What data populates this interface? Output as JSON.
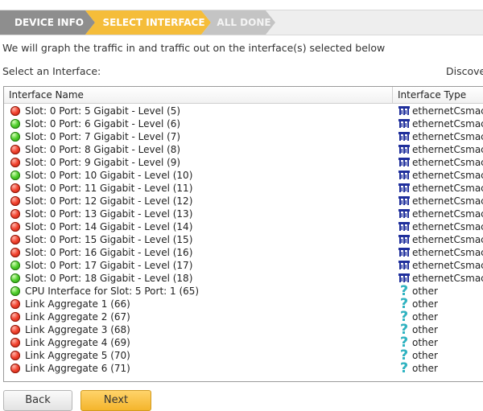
{
  "wizard": {
    "steps": [
      {
        "label": "DEVICE INFO",
        "state": "done"
      },
      {
        "label": "SELECT INTERFACE",
        "state": "active"
      },
      {
        "label": "ALL DONE",
        "state": "pending"
      }
    ]
  },
  "intro_text": "We will graph the traffic in and traffic out on the interface(s) selected below",
  "select_label": "Select an Interface:",
  "discovered_label": "Discovere",
  "table": {
    "columns": [
      "Interface Name",
      "Interface Type"
    ],
    "rows": [
      {
        "status": "red",
        "name": "Slot: 0 Port: 5 Gigabit - Level (5)",
        "type": "ethernetCsmacd",
        "icon": "ethernet-icon"
      },
      {
        "status": "green",
        "name": "Slot: 0 Port: 6 Gigabit - Level (6)",
        "type": "ethernetCsmacd",
        "icon": "ethernet-icon"
      },
      {
        "status": "green",
        "name": "Slot: 0 Port: 7 Gigabit - Level (7)",
        "type": "ethernetCsmacd",
        "icon": "ethernet-icon"
      },
      {
        "status": "red",
        "name": "Slot: 0 Port: 8 Gigabit - Level (8)",
        "type": "ethernetCsmacd",
        "icon": "ethernet-icon"
      },
      {
        "status": "red",
        "name": "Slot: 0 Port: 9 Gigabit - Level (9)",
        "type": "ethernetCsmacd",
        "icon": "ethernet-icon"
      },
      {
        "status": "green",
        "name": "Slot: 0 Port: 10 Gigabit - Level (10)",
        "type": "ethernetCsmacd",
        "icon": "ethernet-icon"
      },
      {
        "status": "red",
        "name": "Slot: 0 Port: 11 Gigabit - Level (11)",
        "type": "ethernetCsmacd",
        "icon": "ethernet-icon"
      },
      {
        "status": "red",
        "name": "Slot: 0 Port: 12 Gigabit - Level (12)",
        "type": "ethernetCsmacd",
        "icon": "ethernet-icon"
      },
      {
        "status": "red",
        "name": "Slot: 0 Port: 13 Gigabit - Level (13)",
        "type": "ethernetCsmacd",
        "icon": "ethernet-icon"
      },
      {
        "status": "red",
        "name": "Slot: 0 Port: 14 Gigabit - Level (14)",
        "type": "ethernetCsmacd",
        "icon": "ethernet-icon"
      },
      {
        "status": "red",
        "name": "Slot: 0 Port: 15 Gigabit - Level (15)",
        "type": "ethernetCsmacd",
        "icon": "ethernet-icon"
      },
      {
        "status": "red",
        "name": "Slot: 0 Port: 16 Gigabit - Level (16)",
        "type": "ethernetCsmacd",
        "icon": "ethernet-icon"
      },
      {
        "status": "green",
        "name": "Slot: 0 Port: 17 Gigabit - Level (17)",
        "type": "ethernetCsmacd",
        "icon": "ethernet-icon"
      },
      {
        "status": "green",
        "name": "Slot: 0 Port: 18 Gigabit - Level (18)",
        "type": "ethernetCsmacd",
        "icon": "ethernet-icon"
      },
      {
        "status": "green",
        "name": "CPU Interface for Slot: 5 Port: 1 (65)",
        "type": "other",
        "icon": "question-icon"
      },
      {
        "status": "red",
        "name": "Link Aggregate 1 (66)",
        "type": "other",
        "icon": "question-icon"
      },
      {
        "status": "red",
        "name": "Link Aggregate 2 (67)",
        "type": "other",
        "icon": "question-icon"
      },
      {
        "status": "red",
        "name": "Link Aggregate 3 (68)",
        "type": "other",
        "icon": "question-icon"
      },
      {
        "status": "red",
        "name": "Link Aggregate 4 (69)",
        "type": "other",
        "icon": "question-icon"
      },
      {
        "status": "red",
        "name": "Link Aggregate 5 (70)",
        "type": "other",
        "icon": "question-icon"
      },
      {
        "status": "red",
        "name": "Link Aggregate 6 (71)",
        "type": "other",
        "icon": "question-icon"
      }
    ]
  },
  "buttons": {
    "back": "Back",
    "next": "Next"
  },
  "colors": {
    "step_done": "#8e8e8e",
    "step_active": "#f5bd3a",
    "step_pending": "#c4c4c4",
    "status_up": "#4fcf2c",
    "status_down": "#f2432f",
    "ethernet_icon": "#1f2f9c",
    "question_icon": "#2fb4c2"
  }
}
